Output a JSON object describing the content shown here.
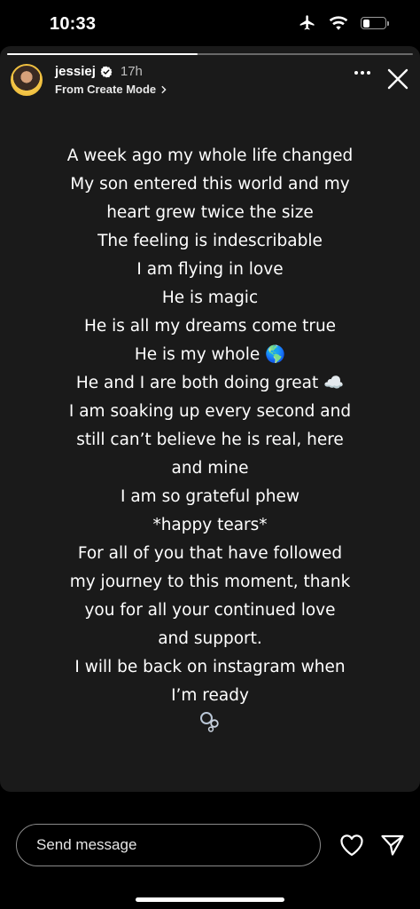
{
  "status_bar": {
    "time": "10:33",
    "icons": [
      "airplane-icon",
      "wifi-icon",
      "battery-icon"
    ],
    "battery_level": 0.3
  },
  "story": {
    "progress": 0.47,
    "username": "jessiej",
    "time_ago": "17h",
    "source": "From Create Mode",
    "text_lines": [
      "A week ago my whole life changed",
      "My son entered this world and my",
      "heart grew twice the size",
      "The feeling is indescribable",
      "I am flying in love",
      "He is magic",
      "He is all my dreams come true",
      "He is my whole 🌎",
      "He and I are both doing great ☁️",
      "I am soaking up every second and",
      "still can’t believe he is real, here",
      "and mine",
      "I am so grateful phew",
      "*happy tears*",
      "For all of you that have followed",
      "my  journey to this moment, thank",
      "you for all your continued love",
      "and support.",
      "I will be back on instagram when",
      "I’m ready"
    ]
  },
  "reply": {
    "placeholder": "Send message"
  },
  "colors": {
    "background": "#000000",
    "card": "#1a1a1a",
    "text": "#ffffff",
    "muted": "#bdbdbd"
  }
}
